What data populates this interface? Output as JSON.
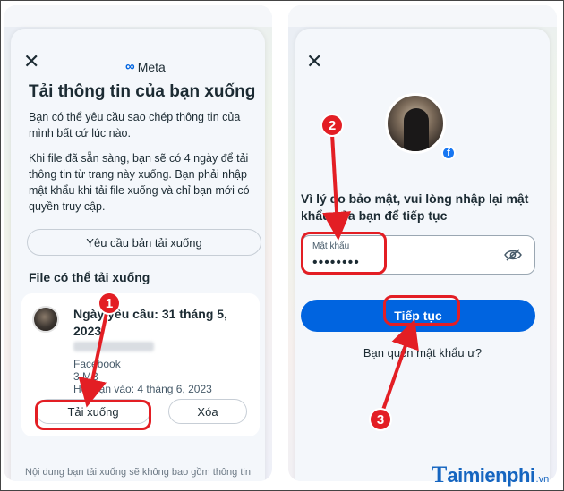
{
  "left_screen": {
    "brand": "Meta",
    "brand_symbol": "∞",
    "title": "Tải thông tin của bạn xuống",
    "intro": "Bạn có thể yêu cầu sao chép thông tin của mình bất cứ lúc nào.",
    "detail": "Khi file đã sẵn sàng, bạn sẽ có 4 ngày để tải thông tin từ trang này xuống. Bạn phải nhập mật khẩu khi tải file xuống và chỉ bạn mới có quyền truy cập.",
    "request_button": "Yêu cầu bản tải xuống",
    "section_heading": "File có thể tải xuống",
    "file": {
      "request_date": "Ngày yêu cầu: 31 tháng 5, 2023",
      "source": "Facebook",
      "size": "3 MB",
      "expiry": "Hết hạn vào: 4 tháng 6, 2023"
    },
    "download_button": "Tải xuống",
    "delete_button": "Xóa",
    "footnote": "Nội dung bạn tải xuống sẽ không bao gồm thông tin"
  },
  "right_screen": {
    "prompt": "Vì lý do bảo mật, vui lòng nhập lại mật khẩu của bạn để tiếp tục",
    "password_label": "Mật khẩu",
    "password_value": "••••••••",
    "continue_button": "Tiếp tục",
    "forgot_link": "Bạn quên mật khẩu ư?",
    "badge_letter": "f"
  },
  "annotations": {
    "step1": "1",
    "step2": "2",
    "step3": "3",
    "color": "#e31e24"
  },
  "watermark": {
    "letter": "T",
    "rest": "aimienphi",
    "suffix": ".vn"
  },
  "colors": {
    "primary": "#0064e0",
    "facebook": "#1877f2",
    "annotation": "#e31e24"
  }
}
